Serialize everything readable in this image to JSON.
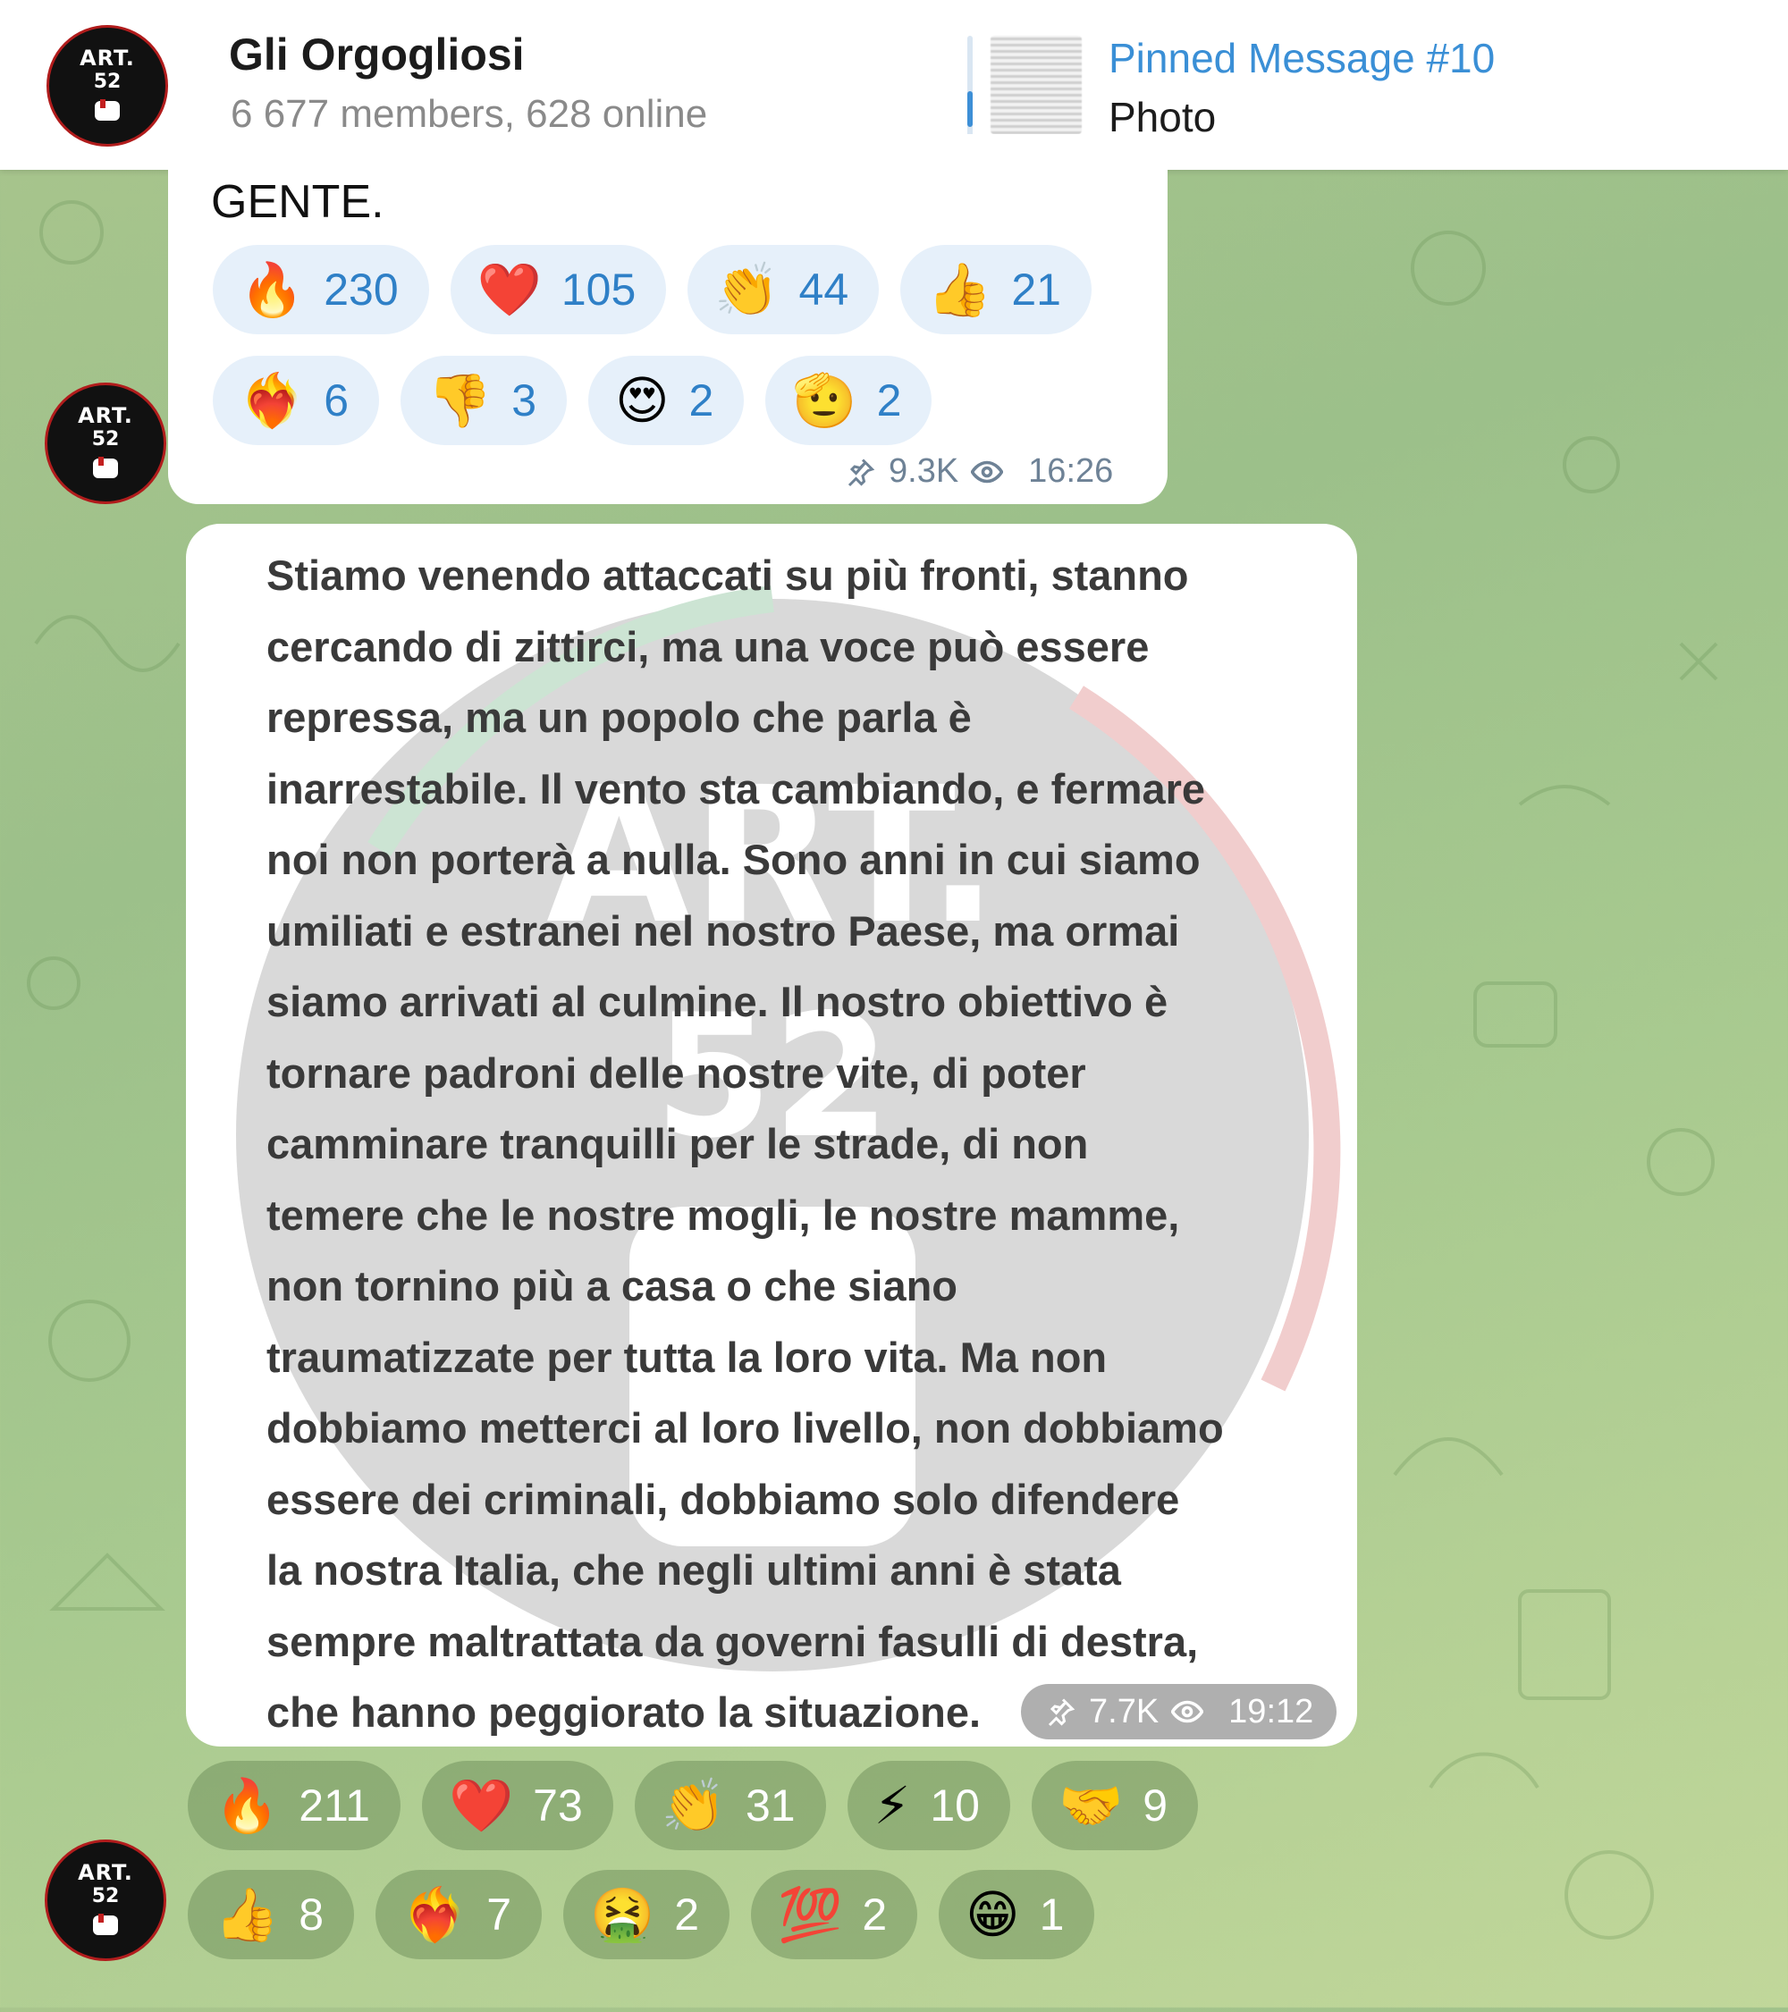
{
  "colors": {
    "accent": "#3a8fd6",
    "reaction_count": "#2f80c7",
    "header_bg": "#ffffff"
  },
  "header": {
    "title": "Gli Orgogliosi",
    "subtitle": "6 677 members, 628 online",
    "avatar_line1": "ART.",
    "avatar_line2": "52",
    "pinned_title": "Pinned Message #10",
    "pinned_sub": "Photo"
  },
  "message1": {
    "text": "GENTE.",
    "reactions_row1": [
      {
        "emoji": "🔥",
        "count": "230"
      },
      {
        "emoji": "❤️",
        "count": "105"
      },
      {
        "emoji": "👏",
        "count": "44"
      },
      {
        "emoji": "👍",
        "count": "21"
      }
    ],
    "reactions_row2": [
      {
        "emoji": "❤️‍🔥",
        "count": "6"
      },
      {
        "emoji": "👎",
        "count": "3"
      },
      {
        "emoji": "😍",
        "count": "2"
      },
      {
        "emoji": "🫡",
        "count": "2"
      }
    ],
    "views": "9.3K",
    "time": "16:26"
  },
  "message2": {
    "lines": [
      "Stiamo venendo attaccati su più fronti, stanno",
      "cercando di zittirci, ma una voce può essere",
      "repressa, ma un popolo che parla è",
      "inarrestabile. Il vento sta cambiando, e fermare",
      "noi non porterà a nulla. Sono anni in cui siamo",
      "umiliati e estranei nel nostro Paese, ma ormai",
      "siamo arrivati al culmine. Il nostro obiettivo è",
      "tornare padroni delle nostre vite, di poter",
      "camminare tranquilli per le strade, di non",
      "temere che le nostre mogli, le nostre mamme,",
      "non tornino più a casa o che siano",
      "traumatizzate per tutta la loro vita. Ma non",
      "dobbiamo metterci al loro livello, non dobbiamo",
      "essere dei criminali, dobbiamo solo difendere",
      "la nostra Italia, che negli ultimi anni è stata",
      "sempre maltrattata da governi fasulli di destra,",
      "che hanno peggiorato la situazione."
    ],
    "watermark_line1": "ART.",
    "watermark_line2": "52",
    "views": "7.7K",
    "time": "19:12",
    "reactions_row1": [
      {
        "emoji": "🔥",
        "count": "211"
      },
      {
        "emoji": "❤️",
        "count": "73"
      },
      {
        "emoji": "👏",
        "count": "31"
      },
      {
        "emoji": "⚡",
        "count": "10"
      },
      {
        "emoji": "🤝",
        "count": "9"
      }
    ],
    "reactions_row2": [
      {
        "emoji": "👍",
        "count": "8"
      },
      {
        "emoji": "❤️‍🔥",
        "count": "7"
      },
      {
        "emoji": "🤮",
        "count": "2"
      },
      {
        "emoji": "💯",
        "count": "2"
      },
      {
        "emoji": "😁",
        "count": "1"
      }
    ]
  }
}
